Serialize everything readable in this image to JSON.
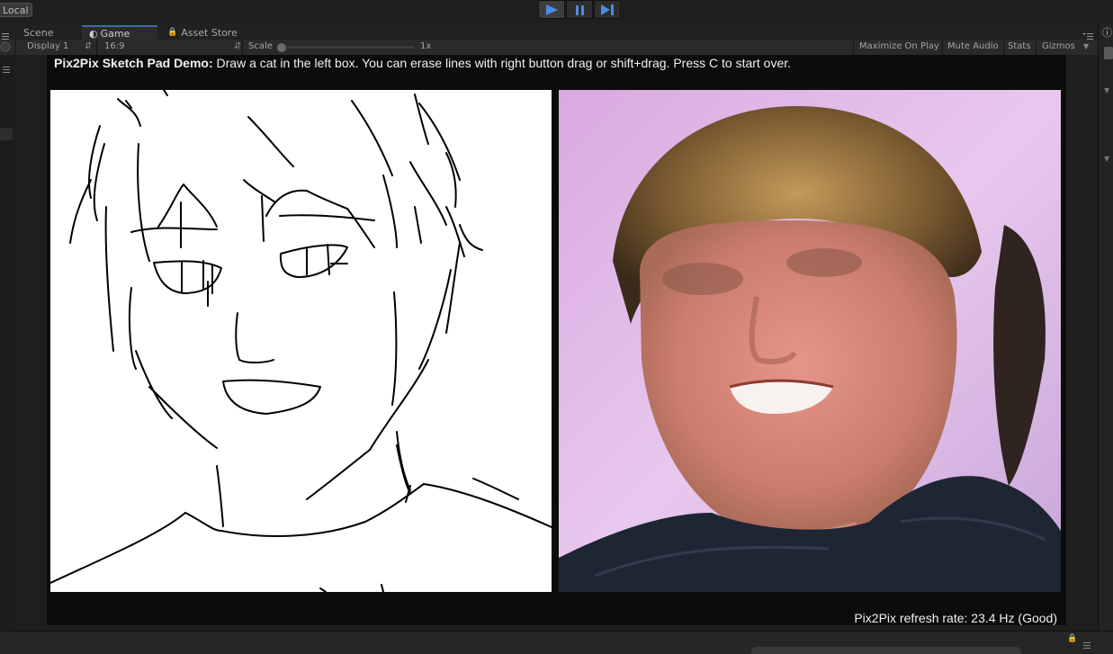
{
  "toolbar": {
    "local_label": "Local",
    "play_icon": "play-icon",
    "pause_icon": "pause-icon",
    "step_icon": "step-icon"
  },
  "tabs": {
    "scene": "Scene",
    "game": "Game",
    "asset_store": "Asset Store"
  },
  "game_toolbar": {
    "display": "Display 1",
    "aspect": "16:9",
    "scale_label": "Scale",
    "scale_value": "1x",
    "maximize_on_play": "Maximize On Play",
    "mute_audio": "Mute Audio",
    "stats": "Stats",
    "gizmos": "Gizmos"
  },
  "demo": {
    "title": "Pix2Pix Sketch Pad Demo:",
    "instructions": " Draw a cat in the left box. You can erase lines with right button drag or shift+drag. Press C to start over.",
    "refresh_rate": "Pix2Pix refresh rate: 23.4 Hz (Good)"
  },
  "colors": {
    "accent": "#3a6ea5",
    "play_active": "#4d8be0"
  }
}
